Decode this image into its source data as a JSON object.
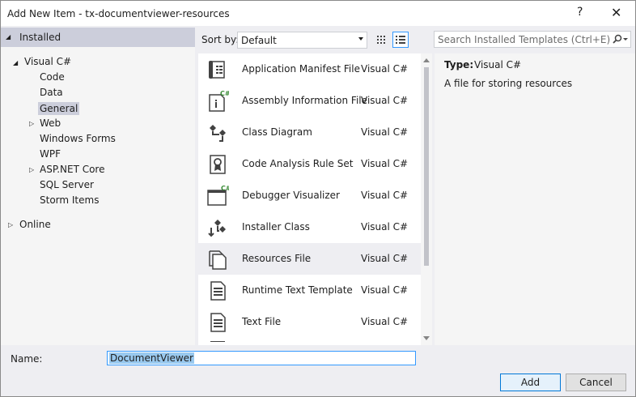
{
  "window": {
    "title": "Add New Item - tx-documentviewer-resources",
    "help": "?",
    "close": "✕"
  },
  "tree": {
    "installed": "Installed",
    "visual_csharp": "Visual C#",
    "children": [
      "Code",
      "Data",
      "General",
      "Web",
      "Windows Forms",
      "WPF",
      "ASP.NET Core",
      "SQL Server",
      "Storm Items"
    ],
    "online": "Online"
  },
  "toolbar": {
    "sort_label": "Sort by:",
    "sort_value": "Default"
  },
  "search": {
    "placeholder": "Search Installed Templates (Ctrl+E)"
  },
  "templates": [
    {
      "name": "Application Manifest File",
      "lang": "Visual C#",
      "icon": "manifest-icon"
    },
    {
      "name": "Assembly Information File",
      "lang": "Visual C#",
      "icon": "assembly-info-icon"
    },
    {
      "name": "Class Diagram",
      "lang": "Visual C#",
      "icon": "class-diagram-icon"
    },
    {
      "name": "Code Analysis Rule Set",
      "lang": "Visual C#",
      "icon": "rule-set-icon"
    },
    {
      "name": "Debugger Visualizer",
      "lang": "Visual C#",
      "icon": "debugger-visualizer-icon"
    },
    {
      "name": "Installer Class",
      "lang": "Visual C#",
      "icon": "installer-class-icon"
    },
    {
      "name": "Resources File",
      "lang": "Visual C#",
      "icon": "resources-file-icon"
    },
    {
      "name": "Runtime Text Template",
      "lang": "Visual C#",
      "icon": "text-template-icon"
    },
    {
      "name": "Text File",
      "lang": "Visual C#",
      "icon": "text-file-icon"
    }
  ],
  "details": {
    "type_label": "Type:",
    "type_value": "Visual C#",
    "description": "A file for storing resources"
  },
  "name_field": {
    "label": "Name:",
    "value": "DocumentViewer"
  },
  "buttons": {
    "add": "Add",
    "cancel": "Cancel"
  }
}
